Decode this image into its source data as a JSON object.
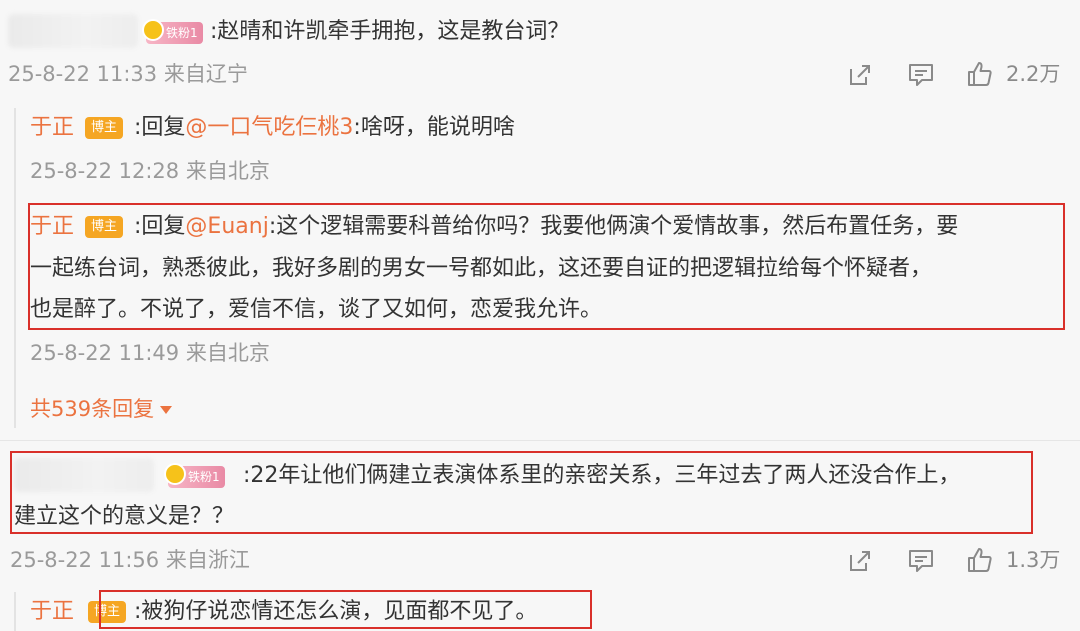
{
  "comments": {
    "c1": {
      "badge": "铁粉1",
      "text": ":赵晴和许凯牵手拥抱，这是教台词？",
      "meta": "25-8-22 11:33 来自辽宁",
      "likes": "2.2万"
    },
    "r1": {
      "author": "于正",
      "badge": "博主",
      "prefix": ":回复",
      "mention": "@一口气吃仨桃3",
      "text": ":啥呀，能说明啥",
      "meta": "25-8-22 12:28 来自北京"
    },
    "r2": {
      "author": "于正",
      "badge": "博主",
      "prefix": ":回复",
      "mention": "@Euanj",
      "line1": ":这个逻辑需要科普给你吗？我要他俩演个爱情故事，然后布置任务，要",
      "line2": "一起练台词，熟悉彼此，我好多剧的男女一号都如此，这还要自证的把逻辑拉给每个怀疑者，",
      "line3": "也是醉了。不说了，爱信不信，谈了又如何，恋爱我允许。",
      "meta": "25-8-22 11:49 来自北京"
    },
    "more_replies": "共539条回复",
    "c2": {
      "badge": "铁粉1",
      "line1": ":22年让他们俩建立表演体系里的亲密关系，三年过去了两人还没合作上，",
      "line2": "建立这个的意义是？？",
      "meta": "25-8-22 11:56 来自浙江",
      "likes": "1.3万"
    },
    "r3": {
      "author": "于正",
      "badge": "博主",
      "text": ":被狗仔说恋情还怎么演，见面都不见了。"
    }
  },
  "icons": [
    "share-icon",
    "comment-icon",
    "like-icon"
  ],
  "colors": {
    "accent": "#eb7340",
    "highlight_box": "#d9302a",
    "fan_badge": "#e98aa5",
    "host_badge": "#f5a623"
  }
}
